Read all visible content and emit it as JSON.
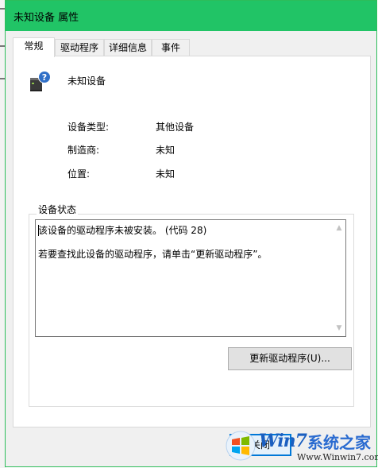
{
  "window": {
    "title": "未知设备 属性"
  },
  "tabs": [
    {
      "label": "常规",
      "active": true
    },
    {
      "label": "驱动程序",
      "active": false
    },
    {
      "label": "详细信息",
      "active": false
    },
    {
      "label": "事件",
      "active": false
    }
  ],
  "general": {
    "device_name": "未知设备",
    "device_icon": "unknown-device-icon",
    "properties": [
      {
        "label": "设备类型:",
        "value": "其他设备"
      },
      {
        "label": "制造商:",
        "value": "未知"
      },
      {
        "label": "位置:",
        "value": "未知"
      }
    ],
    "status_group_title": "设备状态",
    "status_lines": [
      "该设备的驱动程序未被安装。 (代码 28)",
      "若要查找此设备的驱动程序，请单击“更新驱动程序”。"
    ],
    "update_driver_button": "更新驱动程序(U)..."
  },
  "footer": {
    "close_button": "关闭"
  },
  "watermark": {
    "brand": "Win7",
    "cn_name": "系统之家",
    "url": "Www.Winwin7.com"
  },
  "colors": {
    "titlebar": "#21c466",
    "close_focus_border": "#0078d7"
  }
}
